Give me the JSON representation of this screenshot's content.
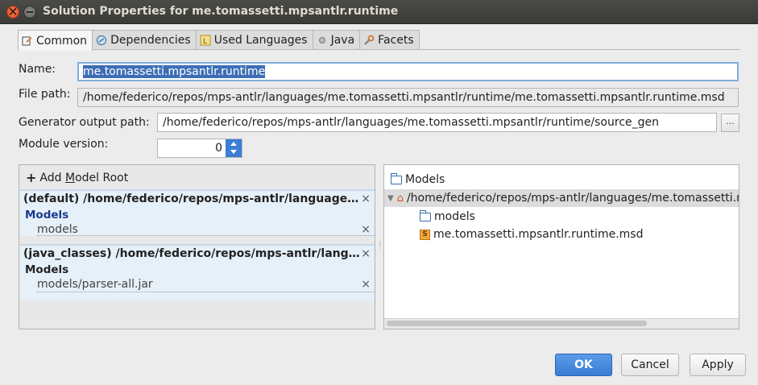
{
  "window": {
    "title": "Solution Properties for me.tomassetti.mpsantlr.runtime"
  },
  "tabs": [
    {
      "label": "Common",
      "icon": "common-icon"
    },
    {
      "label": "Dependencies",
      "icon": "dependencies-icon"
    },
    {
      "label": "Used Languages",
      "icon": "languages-icon"
    },
    {
      "label": "Java",
      "icon": "java-icon"
    },
    {
      "label": "Facets",
      "icon": "facets-icon"
    }
  ],
  "form": {
    "name_label": "Name:",
    "name_value": "me.tomassetti.mpsantlr.runtime",
    "filepath_label": "File path:",
    "filepath_value": "/home/federico/repos/mps-antlr/languages/me.tomassetti.mpsantlr/runtime/me.tomassetti.mpsantlr.runtime.msd",
    "genpath_label": "Generator output path:",
    "genpath_value": "/home/federico/repos/mps-antlr/languages/me.tomassetti.mpsantlr/runtime/source_gen",
    "browse_label": "...",
    "version_label": "Module version:",
    "version_value": "0"
  },
  "model_roots": {
    "add_label": "Add Model Root",
    "add_mnemonic": "M",
    "entries": [
      {
        "header": "(default) /home/federico/repos/mps-antlr/languages/me...",
        "section": "Models",
        "item": "models"
      },
      {
        "header": "(java_classes) /home/federico/repos/mps-antlr/language...",
        "section": "Models",
        "item": "models/parser-all.jar"
      }
    ],
    "remove_glyph": "×"
  },
  "tree": {
    "root_label": "Models",
    "path_label": "/home/federico/repos/mps-antlr/languages/me.tomassetti.mpsantlr/runtime",
    "children": [
      {
        "label": "models",
        "icon": "folder-icon"
      },
      {
        "label": "me.tomassetti.mpsantlr.runtime.msd",
        "icon": "msd-file-icon"
      }
    ]
  },
  "buttons": {
    "ok": "OK",
    "cancel": "Cancel",
    "apply": "Apply"
  },
  "colors": {
    "accent": "#3a7bd5",
    "selection": "#3d6eb5"
  }
}
